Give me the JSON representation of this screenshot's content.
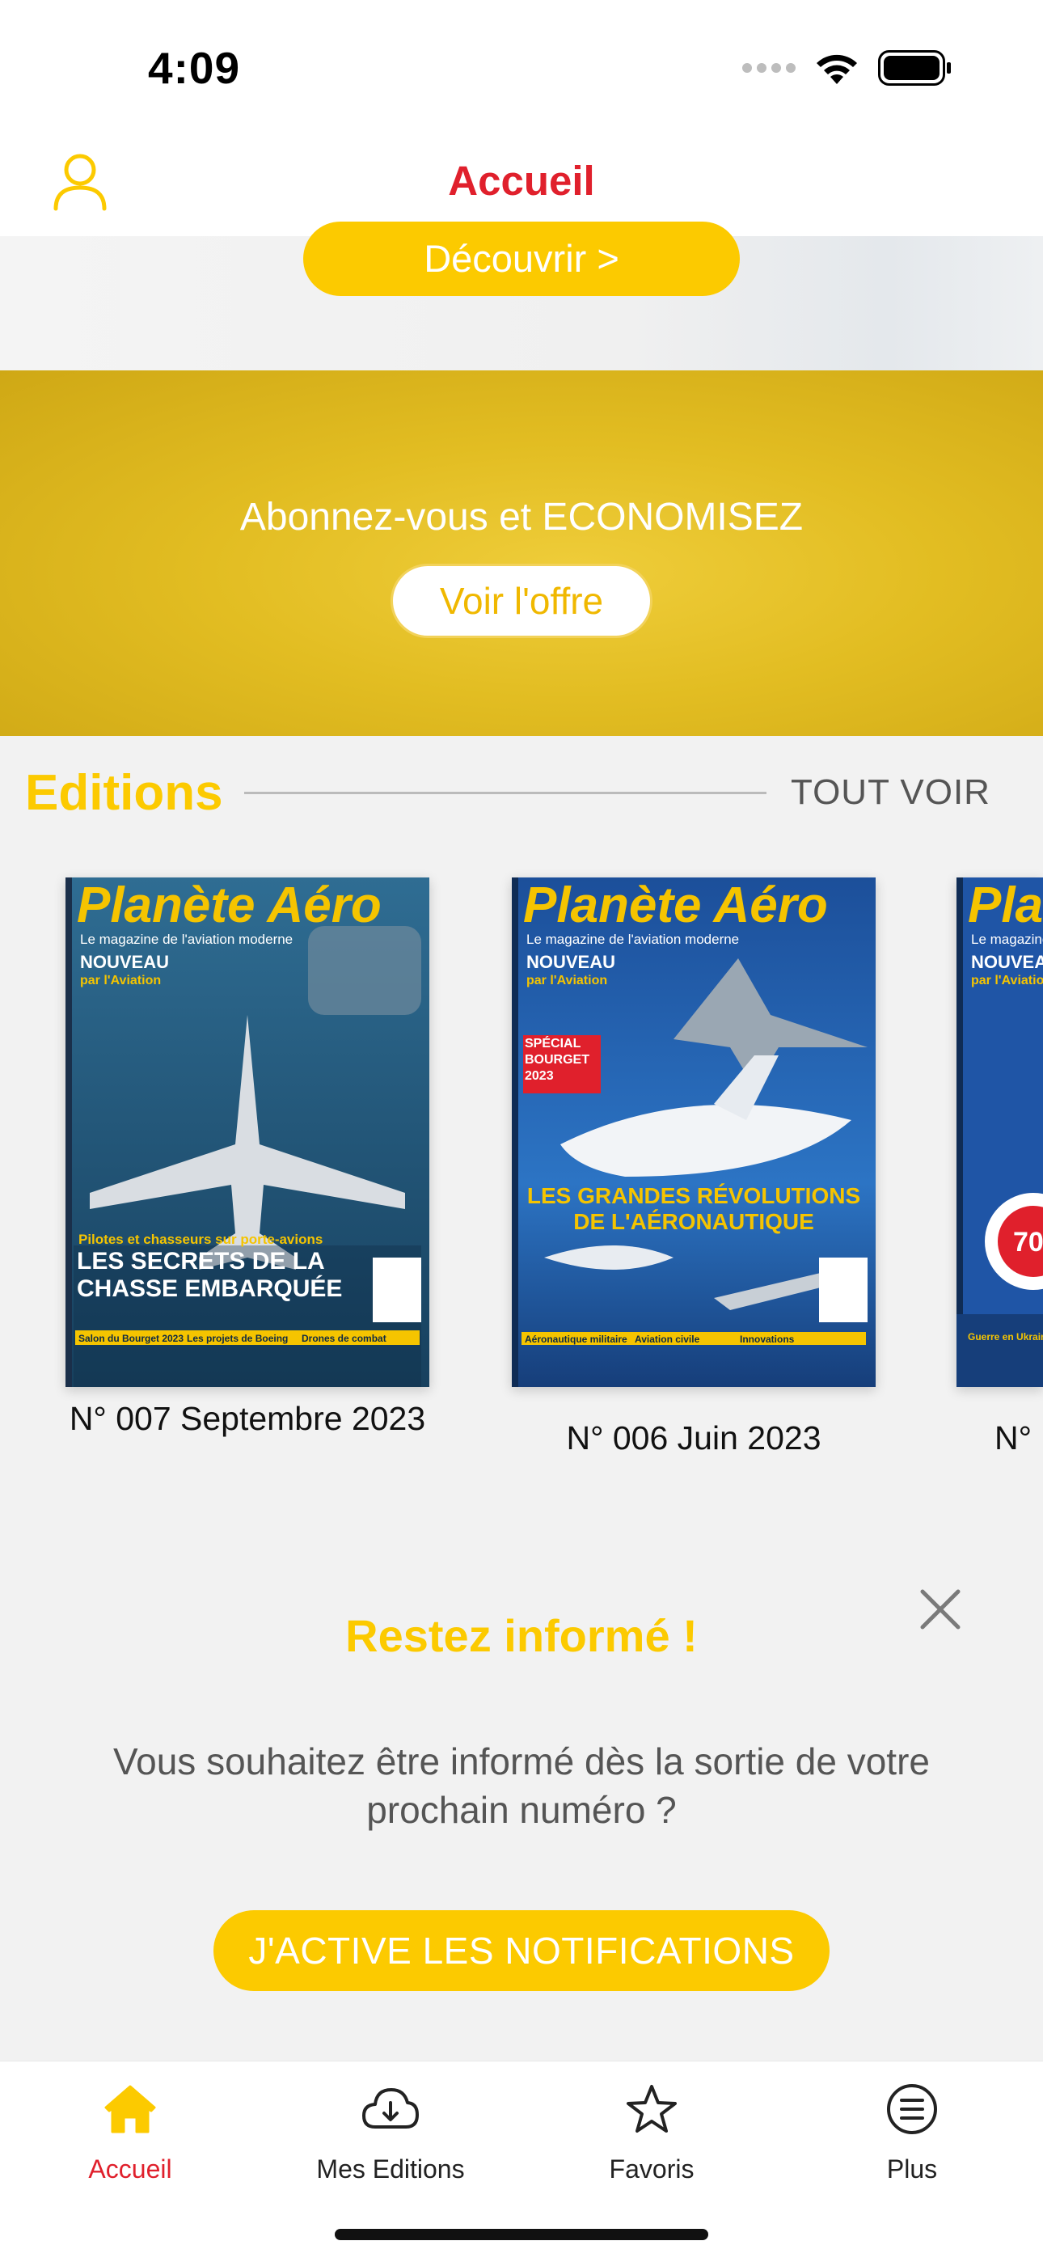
{
  "status_bar": {
    "time": "4:09"
  },
  "header": {
    "title": "Accueil",
    "account_icon": "user-icon"
  },
  "hero": {
    "discover_label": "Découvrir >"
  },
  "promo": {
    "text": "Abonnez-vous et ECONOMISEZ",
    "button_label": "Voir l'offre"
  },
  "editions": {
    "title": "Editions",
    "see_all": "TOUT VOIR",
    "items": [
      {
        "caption": "N° 007 Septembre 2023",
        "masthead": "Planète Aéro",
        "tagline": "Le magazine de l'aviation moderne",
        "badge": "NOUVEAU",
        "badge_sub": "par l'Aviation",
        "kicker": "Pilotes et chasseurs sur porte-avions",
        "headline": "LES SECRETS DE LA CHASSE EMBARQUÉE",
        "bottom": [
          "Salon du Bourget 2023",
          "Les projets de Boeing",
          "Drones de combat"
        ]
      },
      {
        "caption": "N° 006 Juin 2023",
        "masthead": "Planète Aéro",
        "tagline": "Le magazine de l'aviation moderne",
        "badge": "NOUVEAU",
        "badge_sub": "par l'Aviation",
        "kicker": "SPÉCIAL BOURGET 2023",
        "headline": "LES GRANDES RÉVOLUTIONS DE L'AÉRONAUTIQUE",
        "bottom": [
          "Aéronautique militaire",
          "Aviation civile",
          "Innovations"
        ]
      },
      {
        "caption": "N°",
        "masthead": "Pla",
        "tagline": "Le magazine",
        "badge": "NOUVEAU",
        "badge_sub": "par l'Aviation",
        "kicker": "70",
        "headline": "",
        "bottom": [
          "Guerre en Ukraine"
        ]
      }
    ]
  },
  "notify": {
    "title": "Restez informé !",
    "text": "Vous souhaitez être informé dès la sortie de votre prochain numéro ?",
    "button_label": "J'ACTIVE LES NOTIFICATIONS"
  },
  "tabbar": {
    "items": [
      {
        "label": "Accueil",
        "icon": "home-icon",
        "active": true
      },
      {
        "label": "Mes Editions",
        "icon": "cloud-download-icon",
        "active": false
      },
      {
        "label": "Favoris",
        "icon": "star-icon",
        "active": false
      },
      {
        "label": "Plus",
        "icon": "menu-circle-icon",
        "active": false
      }
    ]
  },
  "colors": {
    "accent_yellow": "#fcca00",
    "title_red": "#e0202c",
    "promo_gold": "#e2bd22"
  }
}
